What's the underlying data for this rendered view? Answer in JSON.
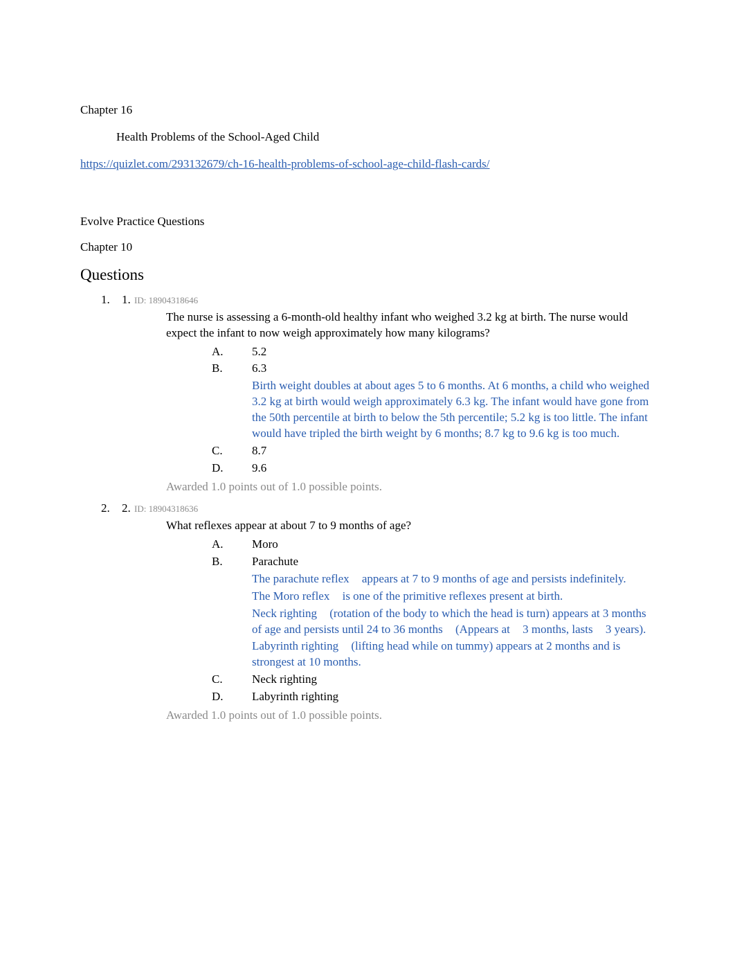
{
  "chapter_top": {
    "label": "Chapter 16",
    "bullet_icon": "",
    "bullet_text": "Health Problems of the School-Aged Child",
    "link": "https://quizlet.com/293132679/ch-16-health-problems-of-school-age-child-flash-cards/"
  },
  "section_heading": "Evolve Practice Questions",
  "chapter_sub": "Chapter 10",
  "questions_heading": "Questions",
  "questions": [
    {
      "outer_num": "1.",
      "inner_num": "1.",
      "id_label": "ID: 18904318646",
      "stem": "The nurse is assessing a 6-month-old healthy infant who weighed 3.2 kg at birth. The nurse would expect the infant to now weigh approximately how many kilograms?",
      "choices": [
        {
          "letter": "A.",
          "text": "5.2",
          "rationale": ""
        },
        {
          "letter": "B.",
          "text": "6.3",
          "rationale": "Birth weight doubles at about ages 5 to 6 months. At 6 months, a child who weighed 3.2 kg at birth would weigh approximately 6.3 kg. The infant would have gone from the 50th percentile at birth to below the 5th percentile; 5.2 kg is too little. The infant would have tripled the birth weight by 6 months; 8.7 kg to 9.6 kg is too much."
        },
        {
          "letter": "C.",
          "text": "8.7",
          "rationale": ""
        },
        {
          "letter": "D.",
          "text": "9.6",
          "rationale": ""
        }
      ],
      "awarded": "Awarded 1.0 points out of 1.0 possible points."
    },
    {
      "outer_num": "2.",
      "inner_num": "2.",
      "id_label": "ID: 18904318636",
      "stem": "What reflexes appear at about 7 to 9 months of age?",
      "choices": [
        {
          "letter": "A.",
          "text": "Moro",
          "rationale": ""
        },
        {
          "letter": "B.",
          "text": "Parachute",
          "rationale_lines": [
            {
              "segments": [
                {
                  "t": "The parachute reflex ",
                  "gap": true
                },
                {
                  "t": "appears at 7 to 9 months of age and persists indefinitely."
                }
              ]
            },
            {
              "segments": [
                {
                  "t": "The Moro reflex ",
                  "gap": true
                },
                {
                  "t": "is one of the primitive reflexes present at birth."
                }
              ]
            },
            {
              "segments": [
                {
                  "t": "Neck righting ",
                  "gap": true
                },
                {
                  "t": "(rotation of the body to which the head is turn) appears at 3 months of age and persists until 24 to 36 months ",
                  "gap": true
                },
                {
                  "t": "(Appears at ",
                  "gap": true
                },
                {
                  "t": "3 months, lasts ",
                  "gap": true
                },
                {
                  "t": "3 years)."
                }
              ]
            },
            {
              "segments": [
                {
                  "t": "Labyrinth righting ",
                  "gap": true
                },
                {
                  "t": "(lifting head while on tummy) appears at 2 months and is strongest at 10 months."
                }
              ]
            }
          ]
        },
        {
          "letter": "C.",
          "text": "Neck righting",
          "rationale": ""
        },
        {
          "letter": "D.",
          "text": "Labyrinth righting",
          "rationale": ""
        }
      ],
      "awarded": "Awarded 1.0 points out of 1.0 possible points."
    }
  ]
}
